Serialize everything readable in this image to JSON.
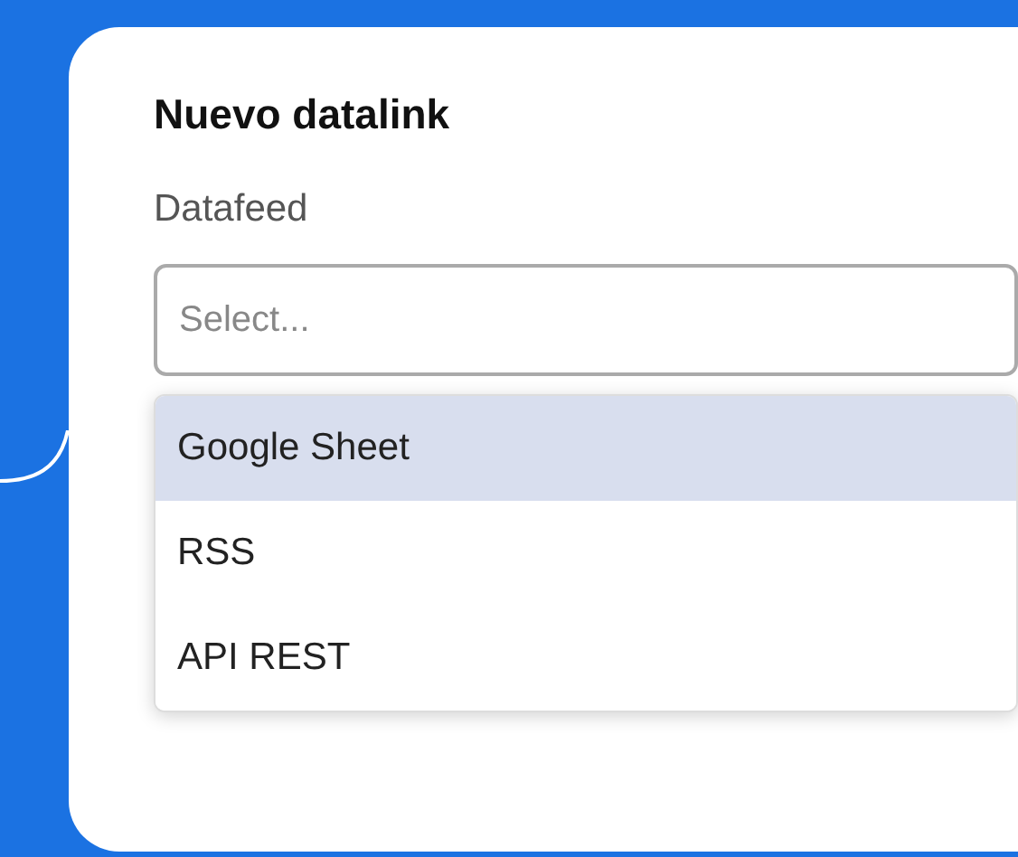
{
  "dialog": {
    "title": "Nuevo datalink",
    "field_label": "Datafeed",
    "select": {
      "placeholder": "Select..."
    },
    "options": [
      {
        "label": "Google Sheet",
        "selected": true
      },
      {
        "label": "RSS",
        "selected": false
      },
      {
        "label": "API REST",
        "selected": false
      }
    ]
  }
}
